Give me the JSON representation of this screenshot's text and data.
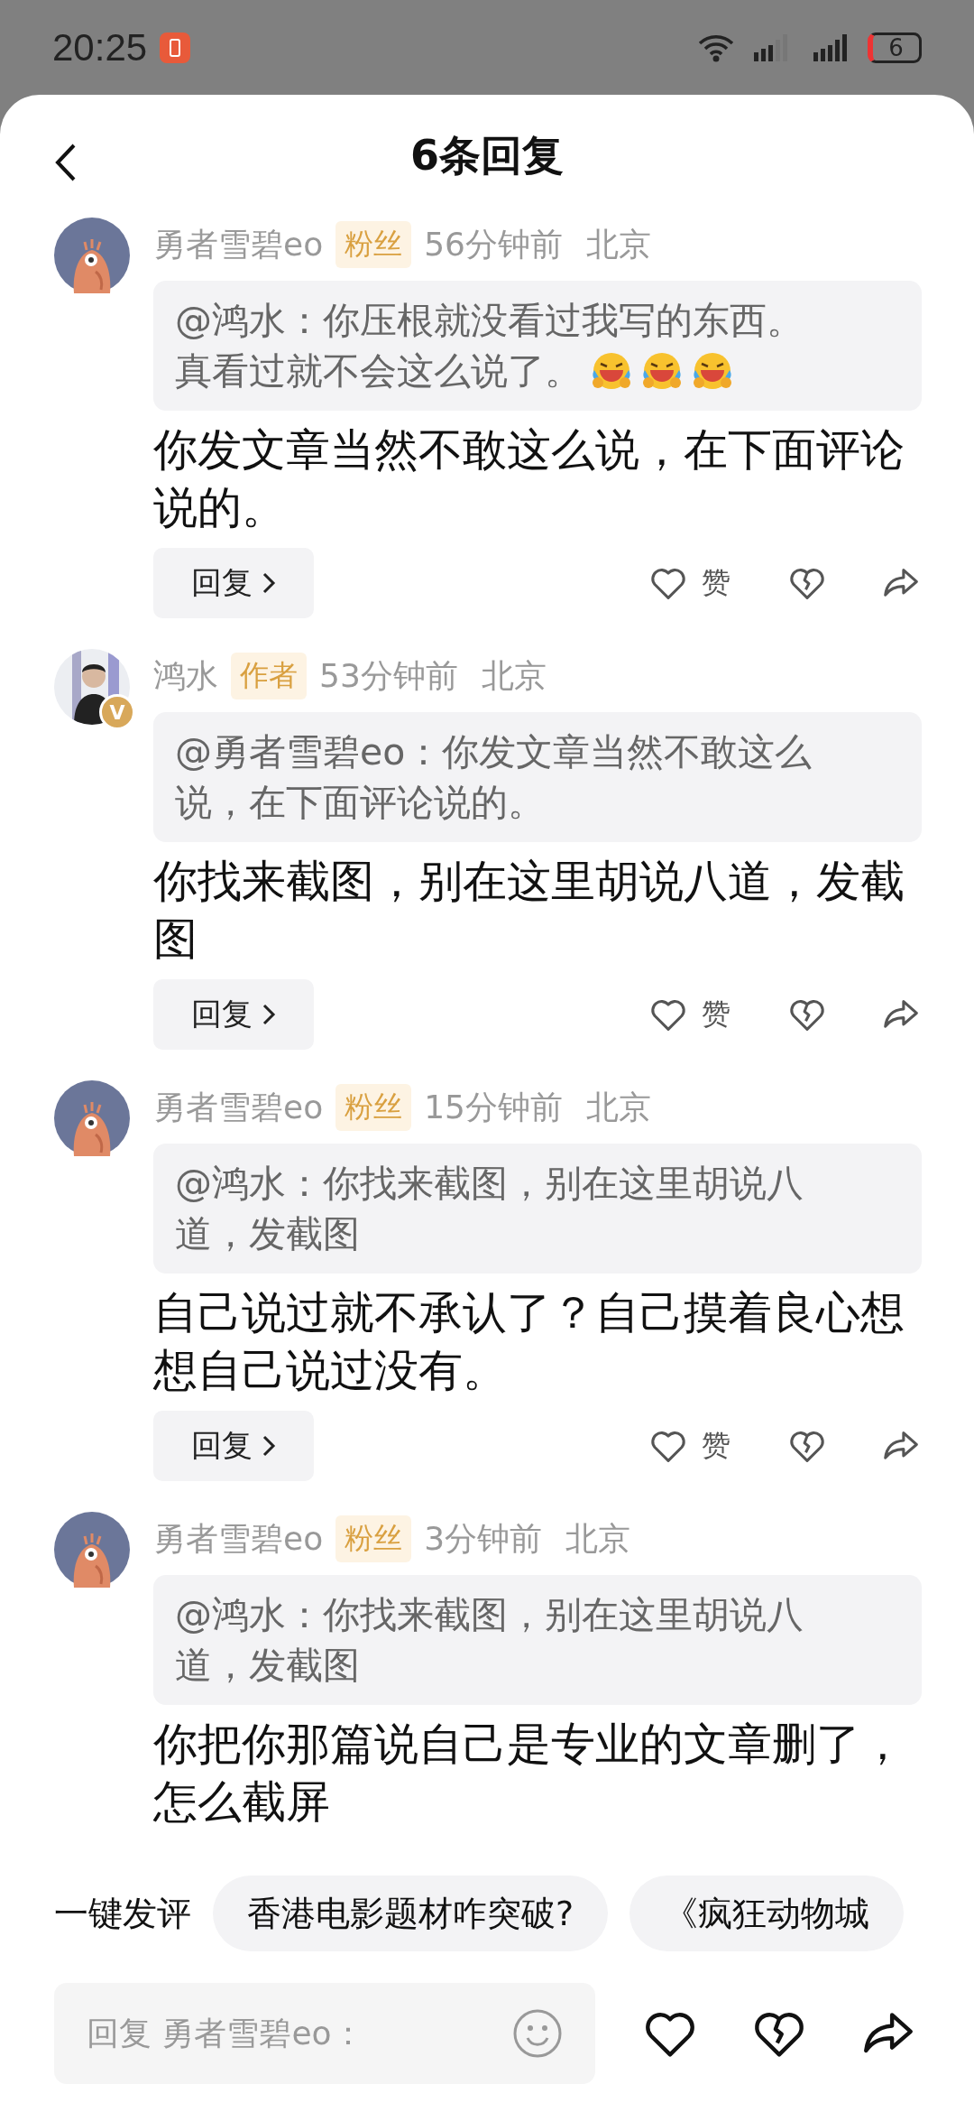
{
  "status_bar": {
    "time": "20:25",
    "battery": "6"
  },
  "header": {
    "title": "6条回复"
  },
  "comments": [
    {
      "author": "勇者雪碧eo",
      "avatar": {
        "kind": "mascot"
      },
      "badge": "粉丝",
      "time": "56分钟前",
      "location": "北京",
      "quote_lines": [
        "@鸿水：你压根就没看过我写的东西。",
        "真看过就不会这么说了。"
      ],
      "emojis": [
        {
          "kind": "laughing-tears"
        },
        {
          "kind": "laughing-tears"
        },
        {
          "kind": "laughing-tears"
        }
      ],
      "text": "你发文章当然不敢这么说，在下面评论说的。",
      "reply": "回复",
      "like": "赞"
    },
    {
      "author": "鸿水",
      "avatar": {
        "kind": "picture"
      },
      "verified": {
        "label": "V"
      },
      "badge": "作者",
      "time": "53分钟前",
      "location": "北京",
      "quote_lines": [
        "@勇者雪碧eo：你发文章当然不敢这么",
        "说，在下面评论说的。"
      ],
      "text": "你找来截图，别在这里胡说八道，发截图",
      "reply": "回复",
      "like": "赞"
    },
    {
      "author": "勇者雪碧eo",
      "avatar": {
        "kind": "mascot"
      },
      "badge": "粉丝",
      "time": "15分钟前",
      "location": "北京",
      "quote_lines": [
        "@鸿水：你找来截图，别在这里胡说八",
        "道，发截图"
      ],
      "text": "自己说过就不承认了？自己摸着良心想想自己说过没有。",
      "reply": "回复",
      "like": "赞"
    },
    {
      "author": "勇者雪碧eo",
      "avatar": {
        "kind": "mascot"
      },
      "badge": "粉丝",
      "time": "3分钟前",
      "location": "北京",
      "quote_lines": [
        "@鸿水：你找来截图，别在这里胡说八",
        "道，发截图"
      ],
      "text": "你把你那篇说自己是专业的文章删了，怎么截屏"
    }
  ],
  "quick_comment": {
    "label": "一键发评",
    "chips": [
      "香港电影题材咋突破?",
      "《疯狂动物城"
    ]
  },
  "input": {
    "placeholder": "回复 勇者雪碧eo："
  }
}
